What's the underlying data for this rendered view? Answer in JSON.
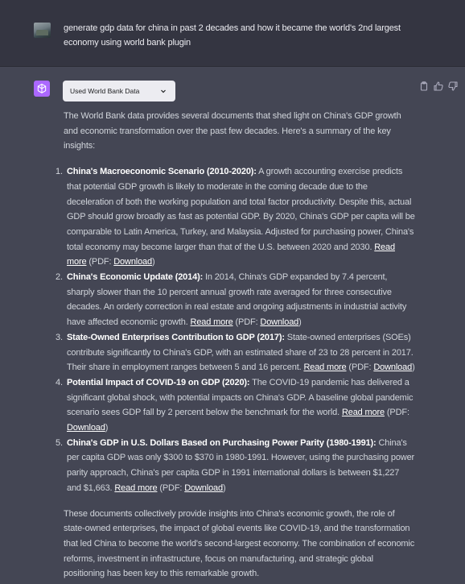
{
  "user": {
    "prompt": "generate gdp data for china in past 2 decades and  how it became the world's 2nd largest economy using world bank plugin"
  },
  "assistant": {
    "plugin_label": "Used World Bank Data",
    "intro": "The World Bank data provides several documents that shed light on China's GDP growth and economic transformation over the past few decades. Here's a summary of the key insights:",
    "items": [
      {
        "num": "1.",
        "title": "China's Macroeconomic Scenario (2010-2020):",
        "body": " A growth accounting exercise predicts that potential GDP growth is likely to moderate in the coming decade due to the deceleration of both the working population and total factor productivity. Despite this, actual GDP should grow broadly as fast as potential GDP. By 2020, China's GDP per capita will be comparable to Latin America, Turkey, and Malaysia. Adjusted for purchasing power, China's total economy may become larger than that of the U.S. between 2020 and 2030. ",
        "read_more": "Read more",
        "pdf_prefix": " (PDF: ",
        "download": "Download",
        "close": ")"
      },
      {
        "num": "2.",
        "title": "China's Economic Update (2014):",
        "body": " In 2014, China's GDP expanded by 7.4 percent, sharply slower than the 10 percent annual growth rate averaged for three consecutive decades. An orderly correction in real estate and ongoing adjustments in industrial activity have affected economic growth. ",
        "read_more": "Read more",
        "pdf_prefix": " (PDF: ",
        "download": "Download",
        "close": ")"
      },
      {
        "num": "3.",
        "title": "State-Owned Enterprises Contribution to GDP (2017):",
        "body": " State-owned enterprises (SOEs) contribute significantly to China's GDP, with an estimated share of 23 to 28 percent in 2017. Their share in employment ranges between 5 and 16 percent. ",
        "read_more": "Read more",
        "pdf_prefix": " (PDF: ",
        "download": "Download",
        "close": ")"
      },
      {
        "num": "4.",
        "title": "Potential Impact of COVID-19 on GDP (2020):",
        "body": " The COVID-19 pandemic has delivered a significant global shock, with potential impacts on China's GDP. A baseline global pandemic scenario sees GDP fall by 2 percent below the benchmark for the world. ",
        "read_more": "Read more",
        "pdf_prefix": " (PDF: ",
        "download": "Download",
        "close": ")"
      },
      {
        "num": "5.",
        "title": "China's GDP in U.S. Dollars Based on Purchasing Power Parity (1980-1991):",
        "body": " China's per capita GDP was only $300 to $370 in 1980-1991. However, using the purchasing power parity approach, China's per capita GDP in 1991 international dollars is between $1,227 and $1,663. ",
        "read_more": "Read more",
        "pdf_prefix": " (PDF: ",
        "download": "Download",
        "close": ")"
      }
    ],
    "outro": "These documents collectively provide insights into China's economic growth, the role of state-owned enterprises, the impact of global events like COVID-19, and the transformation that led China to become the world's second-largest economy. The combination of economic reforms, investment in infrastructure, focus on manufacturing, and strategic global positioning has been key to this remarkable growth."
  },
  "icons": {
    "user_avatar": "user-photo-avatar",
    "assistant_avatar": "openai-logo-icon",
    "chip_chevron": "chevron-down-icon",
    "copy": "clipboard-icon",
    "thumbs_up": "thumbs-up-icon",
    "thumbs_down": "thumbs-down-icon"
  },
  "colors": {
    "user_bg": "#343541",
    "assistant_bg": "#444654",
    "assistant_avatar": "#ab68ff",
    "text": "#d1d5db"
  }
}
